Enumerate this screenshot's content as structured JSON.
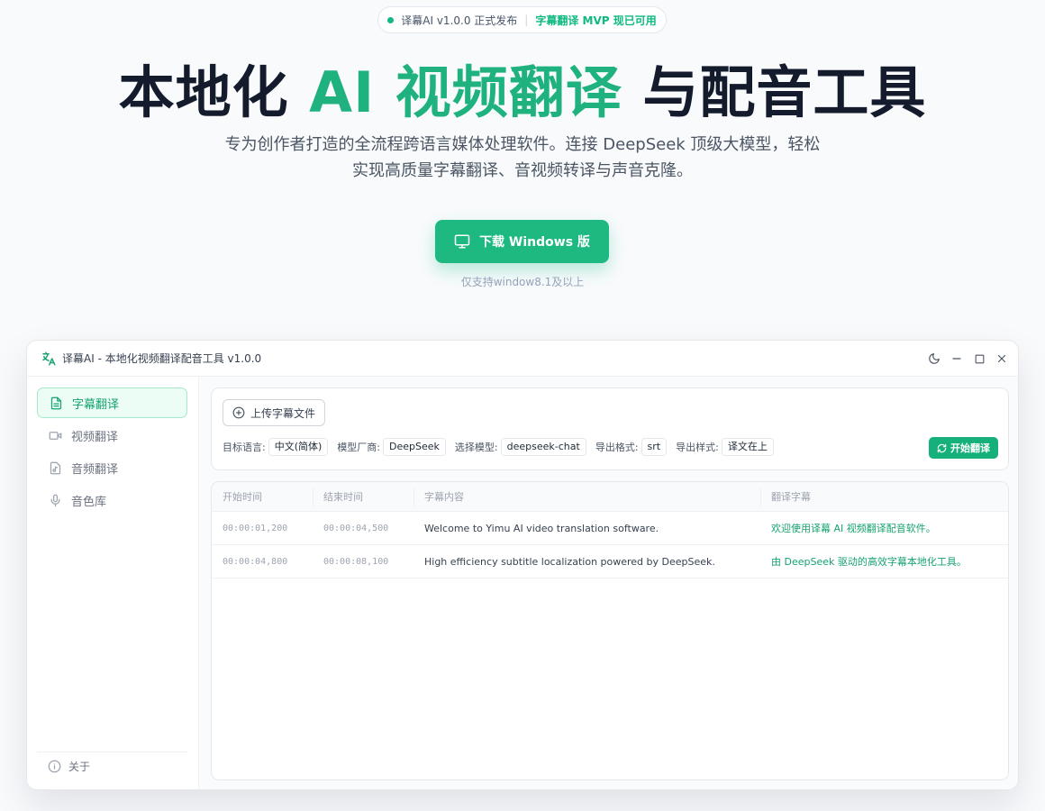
{
  "hero": {
    "badge_version": "译幕AI v1.0.0 正式发布",
    "badge_sep": "|",
    "badge_highlight": "字幕翻译 MVP 现已可用",
    "title_part1": "本地化 ",
    "title_accent": "AI 视频翻译",
    "title_part2": " 与配音工具",
    "subtitle_line1": "专为创作者打造的全流程跨语言媒体处理软件。连接 DeepSeek 顶级大模型，轻松",
    "subtitle_line2": "实现高质量字幕翻译、音视频转译与声音克隆。",
    "download_label": "下载 Windows 版",
    "download_note": "仅支持window8.1及以上"
  },
  "app": {
    "window_title": "译幕AI - 本地化视频翻译配音工具 v1.0.0",
    "sidebar": {
      "items": [
        {
          "label": "字幕翻译",
          "icon": "document-icon"
        },
        {
          "label": "视频翻译",
          "icon": "video-icon"
        },
        {
          "label": "音频翻译",
          "icon": "music-icon"
        },
        {
          "label": "音色库",
          "icon": "microphone-icon"
        }
      ],
      "about_label": "关于"
    },
    "toolbar": {
      "upload_label": "上传字幕文件",
      "target_lang_label": "目标语言:",
      "target_lang_value": "中文(简体)",
      "vendor_label": "模型厂商:",
      "vendor_value": "DeepSeek",
      "model_label": "选择模型:",
      "model_value": "deepseek-chat",
      "format_label": "导出格式:",
      "format_value": "srt",
      "style_label": "导出样式:",
      "style_value": "译文在上",
      "start_label": "开始翻译"
    },
    "table": {
      "headers": [
        "开始时间",
        "结束时间",
        "字幕内容",
        "翻译字幕"
      ],
      "rows": [
        {
          "start": "00:00:01,200",
          "end": "00:00:04,500",
          "text": "Welcome to Yimu AI video translation software.",
          "translation": "欢迎使用译幕 AI 视频翻译配音软件。"
        },
        {
          "start": "00:00:04,800",
          "end": "00:00:08,100",
          "text": "High efficiency subtitle localization powered by DeepSeek.",
          "translation": "由 DeepSeek 驱动的高效字幕本地化工具。"
        }
      ]
    }
  },
  "colors": {
    "accent": "#1fb27f",
    "title": "#141b2d",
    "background": "#f8fafc"
  }
}
